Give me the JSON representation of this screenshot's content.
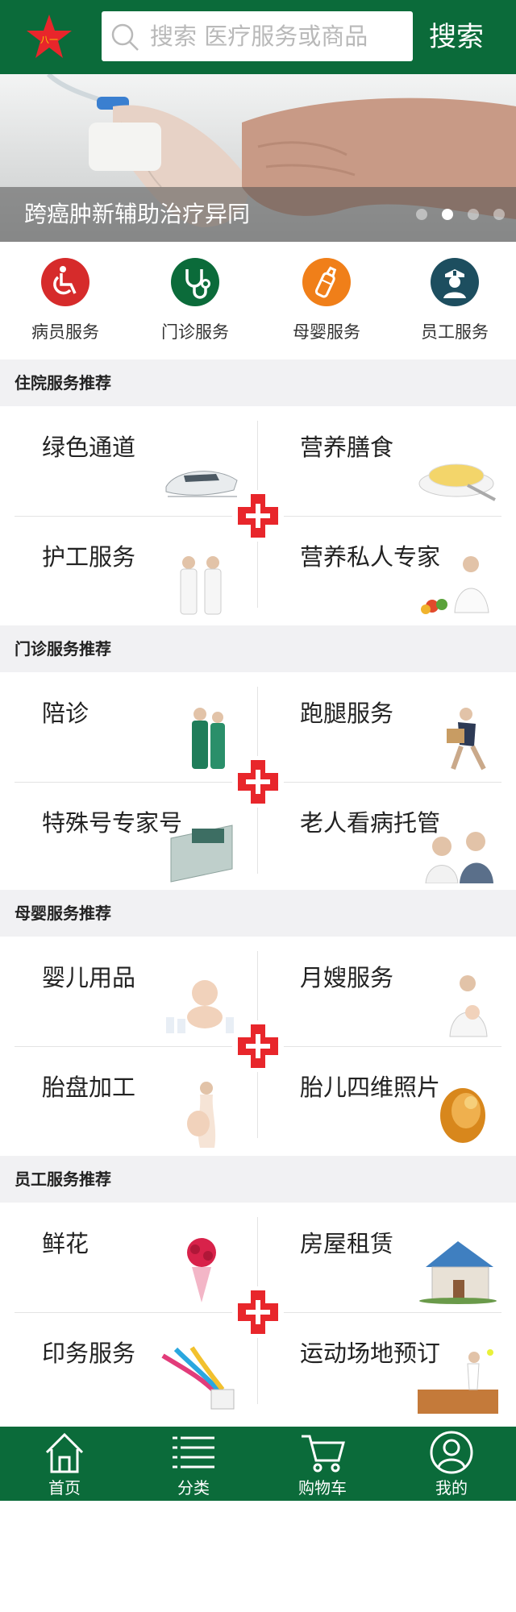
{
  "header": {
    "logo": "red-star-logo",
    "search_placeholder": "搜索 医疗服务或商品",
    "search_button": "搜索",
    "bg_color": "#0b6b3a"
  },
  "banner": {
    "caption": "跨癌肿新辅助治疗异同",
    "slide_count": 4,
    "active_slide": 2
  },
  "categories": [
    {
      "label": "病员服务",
      "icon": "wheelchair-icon",
      "color": "#d62b2b"
    },
    {
      "label": "门诊服务",
      "icon": "stethoscope-icon",
      "color": "#0b6b3a"
    },
    {
      "label": "母婴服务",
      "icon": "baby-bottle-icon",
      "color": "#f07f19"
    },
    {
      "label": "员工服务",
      "icon": "nurse-icon",
      "color": "#1d4e5f"
    }
  ],
  "sections": [
    {
      "title": "住院服务推荐",
      "items": [
        "绿色通道",
        "营养膳食",
        "护工服务",
        "营养私人专家"
      ]
    },
    {
      "title": "门诊服务推荐",
      "items": [
        "陪诊",
        "跑腿服务",
        "特殊号专家号",
        "老人看病托管"
      ]
    },
    {
      "title": "母婴服务推荐",
      "items": [
        "婴儿用品",
        "月嫂服务",
        "胎盘加工",
        "胎儿四维照片"
      ]
    },
    {
      "title": "员工服务推荐",
      "items": [
        "鲜花",
        "房屋租赁",
        "印务服务",
        "运动场地预订"
      ]
    }
  ],
  "tabs": [
    {
      "label": "首页",
      "icon": "home-icon"
    },
    {
      "label": "分类",
      "icon": "list-icon"
    },
    {
      "label": "购物车",
      "icon": "cart-icon"
    },
    {
      "label": "我的",
      "icon": "user-icon"
    }
  ],
  "accent_red": "#e8262b"
}
